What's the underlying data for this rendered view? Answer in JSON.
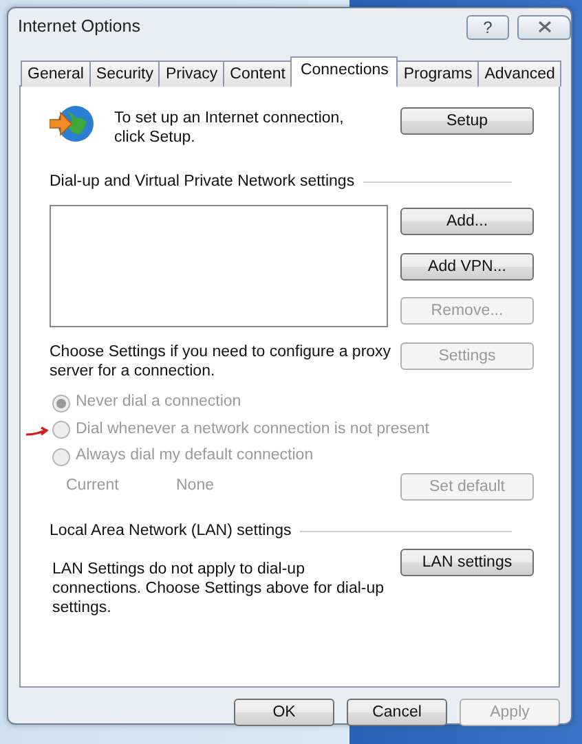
{
  "window": {
    "title": "Internet Options",
    "help_button": "?"
  },
  "tabs": [
    {
      "label": "General",
      "selected": false
    },
    {
      "label": "Security",
      "selected": false
    },
    {
      "label": "Privacy",
      "selected": false
    },
    {
      "label": "Content",
      "selected": false
    },
    {
      "label": "Connections",
      "selected": true
    },
    {
      "label": "Programs",
      "selected": false
    },
    {
      "label": "Advanced",
      "selected": false
    }
  ],
  "setup": {
    "text": "To set up an Internet connection, click Setup.",
    "button": {
      "label": "Setup",
      "disabled": false
    }
  },
  "dialup": {
    "heading": "Dial-up and Virtual Private Network settings",
    "buttons": [
      {
        "label": "Add...",
        "disabled": false
      },
      {
        "label": "Add VPN...",
        "disabled": false
      },
      {
        "label": "Remove...",
        "disabled": true
      }
    ],
    "proxy_text": "Choose Settings if you need to configure a proxy server for a connection.",
    "settings_button": {
      "label": "Settings",
      "disabled": true
    },
    "options": [
      {
        "label": "Never dial a connection",
        "selected": true,
        "disabled": true
      },
      {
        "label": "Dial whenever a network connection is not present",
        "selected": false,
        "disabled": true
      },
      {
        "label": "Always dial my default connection",
        "selected": false,
        "disabled": true
      }
    ],
    "current_label": "Current",
    "current_value": "None",
    "set_default_button": {
      "label": "Set default",
      "disabled": true
    }
  },
  "lan": {
    "heading": "Local Area Network (LAN) settings",
    "text": "LAN Settings do not apply to dial-up connections. Choose Settings above for dial-up settings.",
    "button": {
      "label": "LAN settings",
      "disabled": false
    }
  },
  "footer_buttons": [
    {
      "label": "OK",
      "disabled": false
    },
    {
      "label": "Cancel",
      "disabled": false
    },
    {
      "label": "Apply",
      "disabled": true
    }
  ]
}
